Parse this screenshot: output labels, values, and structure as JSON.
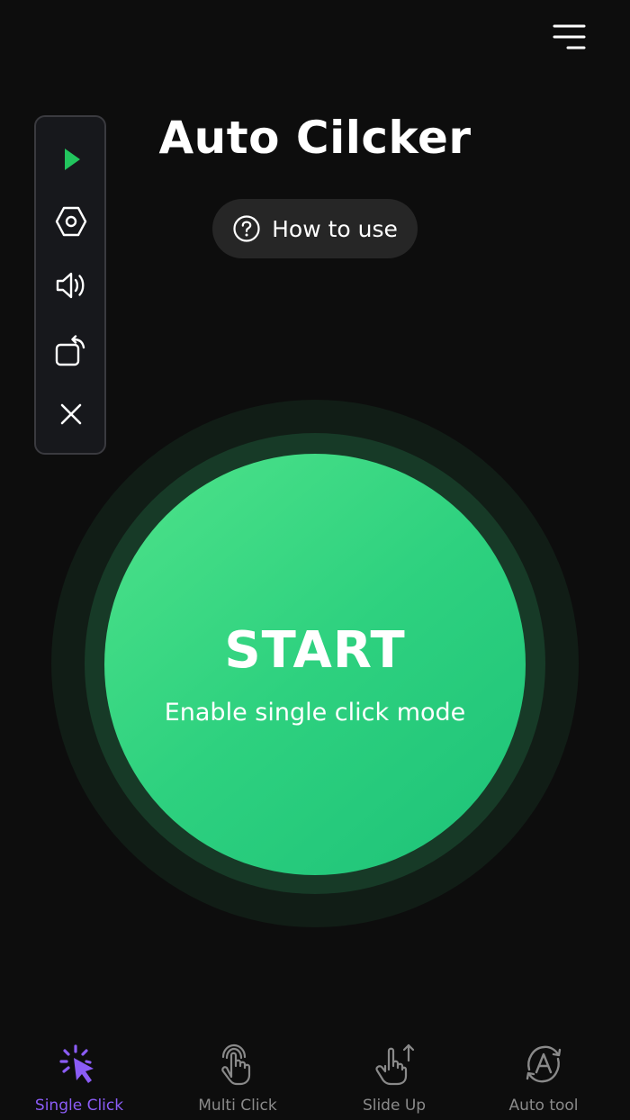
{
  "header": {
    "title": "Auto Cilcker",
    "menu_icon": "hamburger-menu-icon"
  },
  "help": {
    "label": "How to use",
    "icon": "question-circle-icon"
  },
  "float_panel": {
    "items": [
      {
        "name": "play",
        "icon": "play-icon",
        "color": "#22c55e"
      },
      {
        "name": "settings",
        "icon": "hexagon-settings-icon"
      },
      {
        "name": "sound",
        "icon": "speaker-icon"
      },
      {
        "name": "rotate",
        "icon": "rotate-icon"
      },
      {
        "name": "close",
        "icon": "close-icon"
      }
    ]
  },
  "start": {
    "label": "START",
    "subtitle": "Enable single click mode",
    "color": "#2ed17f"
  },
  "nav": {
    "items": [
      {
        "label": "Single Click",
        "icon": "tap-cursor-icon",
        "active": true
      },
      {
        "label": "Multi Click",
        "icon": "multi-touch-hand-icon",
        "active": false
      },
      {
        "label": "Slide Up",
        "icon": "swipe-up-hand-icon",
        "active": false
      },
      {
        "label": "Auto tool",
        "icon": "auto-a-icon",
        "active": false
      }
    ],
    "active_color": "#8b5cf6",
    "inactive_color": "#8a8a8a"
  }
}
